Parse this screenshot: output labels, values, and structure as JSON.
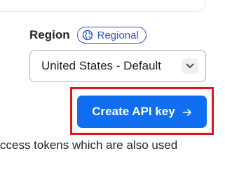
{
  "region": {
    "label": "Region",
    "badge_label": "Regional",
    "badge_icon": "globe-icon",
    "select_value": "United States - Default",
    "select_icon": "chevron-down-icon"
  },
  "actions": {
    "create_label": "Create API key",
    "create_icon": "arrow-right-icon"
  },
  "description": {
    "text": "ccess tokens which are also used"
  },
  "colors": {
    "accent": "#0f6ff0",
    "badge": "#2f55d4",
    "highlight": "#e0141e"
  }
}
